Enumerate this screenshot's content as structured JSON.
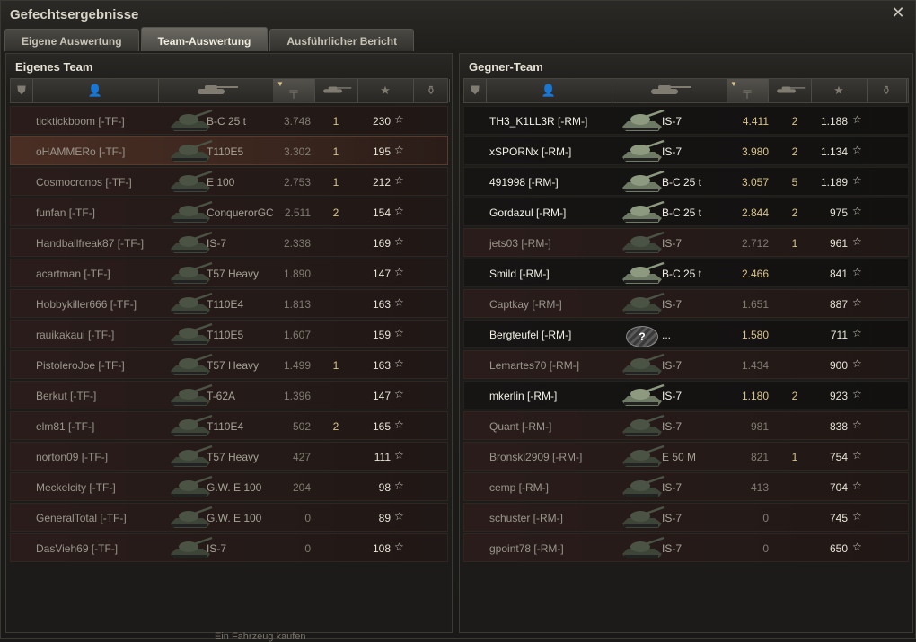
{
  "window": {
    "title": "Gefechtsergebnisse"
  },
  "tabs": [
    {
      "label": "Eigene Auswertung",
      "active": false
    },
    {
      "label": "Team-Auswertung",
      "active": true
    },
    {
      "label": "Ausführlicher Bericht",
      "active": false
    }
  ],
  "colors": {
    "accent_gold": "#d7c48a",
    "dead_row": "#2a1c1a",
    "self_row": "#4a2e24"
  },
  "header_icons": [
    "platoon-icon",
    "player-icon",
    "tank-icon",
    "damage-icon",
    "kills-icon",
    "xp-star-icon",
    "medal-icon"
  ],
  "own_team": {
    "title": "Eigenes Team",
    "rows": [
      {
        "player": "ticktickboom [-TF-]",
        "vehicle": "B-C 25 t",
        "damage": "3.748",
        "kills": "1",
        "xp": "230",
        "alive": false,
        "self": false
      },
      {
        "player": "oHAMMERo [-TF-]",
        "vehicle": "T110E5",
        "damage": "3.302",
        "kills": "1",
        "xp": "195",
        "alive": false,
        "self": true
      },
      {
        "player": "Cosmocronos [-TF-]",
        "vehicle": "E 100",
        "damage": "2.753",
        "kills": "1",
        "xp": "212",
        "alive": false,
        "self": false
      },
      {
        "player": "funfan [-TF-]",
        "vehicle": "ConquerorGC",
        "damage": "2.511",
        "kills": "2",
        "xp": "154",
        "alive": false,
        "self": false
      },
      {
        "player": "Handballfreak87 [-TF-]",
        "vehicle": "IS-7",
        "damage": "2.338",
        "kills": "",
        "xp": "169",
        "alive": false,
        "self": false
      },
      {
        "player": "acartman [-TF-]",
        "vehicle": "T57 Heavy",
        "damage": "1.890",
        "kills": "",
        "xp": "147",
        "alive": false,
        "self": false
      },
      {
        "player": "Hobbykiller666 [-TF-]",
        "vehicle": "T110E4",
        "damage": "1.813",
        "kills": "",
        "xp": "163",
        "alive": false,
        "self": false
      },
      {
        "player": "rauikakaui [-TF-]",
        "vehicle": "T110E5",
        "damage": "1.607",
        "kills": "",
        "xp": "159",
        "alive": false,
        "self": false
      },
      {
        "player": "PistoleroJoe [-TF-]",
        "vehicle": "T57 Heavy",
        "damage": "1.499",
        "kills": "1",
        "xp": "163",
        "alive": false,
        "self": false
      },
      {
        "player": "Berkut [-TF-]",
        "vehicle": "T-62A",
        "damage": "1.396",
        "kills": "",
        "xp": "147",
        "alive": false,
        "self": false
      },
      {
        "player": "elm81 [-TF-]",
        "vehicle": "T110E4",
        "damage": "502",
        "kills": "2",
        "xp": "165",
        "alive": false,
        "self": false
      },
      {
        "player": "norton09 [-TF-]",
        "vehicle": "T57 Heavy",
        "damage": "427",
        "kills": "",
        "xp": "111",
        "alive": false,
        "self": false
      },
      {
        "player": "Meckelcity [-TF-]",
        "vehicle": "G.W. E 100",
        "damage": "204",
        "kills": "",
        "xp": "98",
        "alive": false,
        "self": false
      },
      {
        "player": "GeneralTotal [-TF-]",
        "vehicle": "G.W. E 100",
        "damage": "0",
        "kills": "",
        "xp": "89",
        "alive": false,
        "self": false
      },
      {
        "player": "DasVieh69 [-TF-]",
        "vehicle": "IS-7",
        "damage": "0",
        "kills": "",
        "xp": "108",
        "alive": false,
        "self": false
      }
    ]
  },
  "enemy_team": {
    "title": "Gegner-Team",
    "rows": [
      {
        "player": "TH3_K1LL3R [-RM-]",
        "vehicle": "IS-7",
        "damage": "4.411",
        "kills": "2",
        "xp": "1.188",
        "alive": true
      },
      {
        "player": "xSPORNx [-RM-]",
        "vehicle": "IS-7",
        "damage": "3.980",
        "kills": "2",
        "xp": "1.134",
        "alive": true
      },
      {
        "player": "491998 [-RM-]",
        "vehicle": "B-C 25 t",
        "damage": "3.057",
        "kills": "5",
        "xp": "1.189",
        "alive": true
      },
      {
        "player": "Gordazul [-RM-]",
        "vehicle": "B-C 25 t",
        "damage": "2.844",
        "kills": "2",
        "xp": "975",
        "alive": true
      },
      {
        "player": "jets03 [-RM-]",
        "vehicle": "IS-7",
        "damage": "2.712",
        "kills": "1",
        "xp": "961",
        "alive": false
      },
      {
        "player": "Smild [-RM-]",
        "vehicle": "B-C 25 t",
        "damage": "2.466",
        "kills": "",
        "xp": "841",
        "alive": true
      },
      {
        "player": "Captkay [-RM-]",
        "vehicle": "IS-7",
        "damage": "1.651",
        "kills": "",
        "xp": "887",
        "alive": false
      },
      {
        "player": "Bergteufel [-RM-]",
        "vehicle": "...",
        "damage": "1.580",
        "kills": "",
        "xp": "711",
        "alive": true,
        "unknown": true
      },
      {
        "player": "Lemartes70 [-RM-]",
        "vehicle": "IS-7",
        "damage": "1.434",
        "kills": "",
        "xp": "900",
        "alive": false
      },
      {
        "player": "mkerlin [-RM-]",
        "vehicle": "IS-7",
        "damage": "1.180",
        "kills": "2",
        "xp": "923",
        "alive": true
      },
      {
        "player": "Quant [-RM-]",
        "vehicle": "IS-7",
        "damage": "981",
        "kills": "",
        "xp": "838",
        "alive": false
      },
      {
        "player": "Bronski2909 [-RM-]",
        "vehicle": "E 50 M",
        "damage": "821",
        "kills": "1",
        "xp": "754",
        "alive": false
      },
      {
        "player": "cemp [-RM-]",
        "vehicle": "IS-7",
        "damage": "413",
        "kills": "",
        "xp": "704",
        "alive": false
      },
      {
        "player": "schuster [-RM-]",
        "vehicle": "IS-7",
        "damage": "0",
        "kills": "",
        "xp": "745",
        "alive": false
      },
      {
        "player": "gpoint78 [-RM-]",
        "vehicle": "IS-7",
        "damage": "0",
        "kills": "",
        "xp": "650",
        "alive": false
      }
    ]
  },
  "footer": {
    "hint": "Ein Fahrzeug kaufen"
  }
}
